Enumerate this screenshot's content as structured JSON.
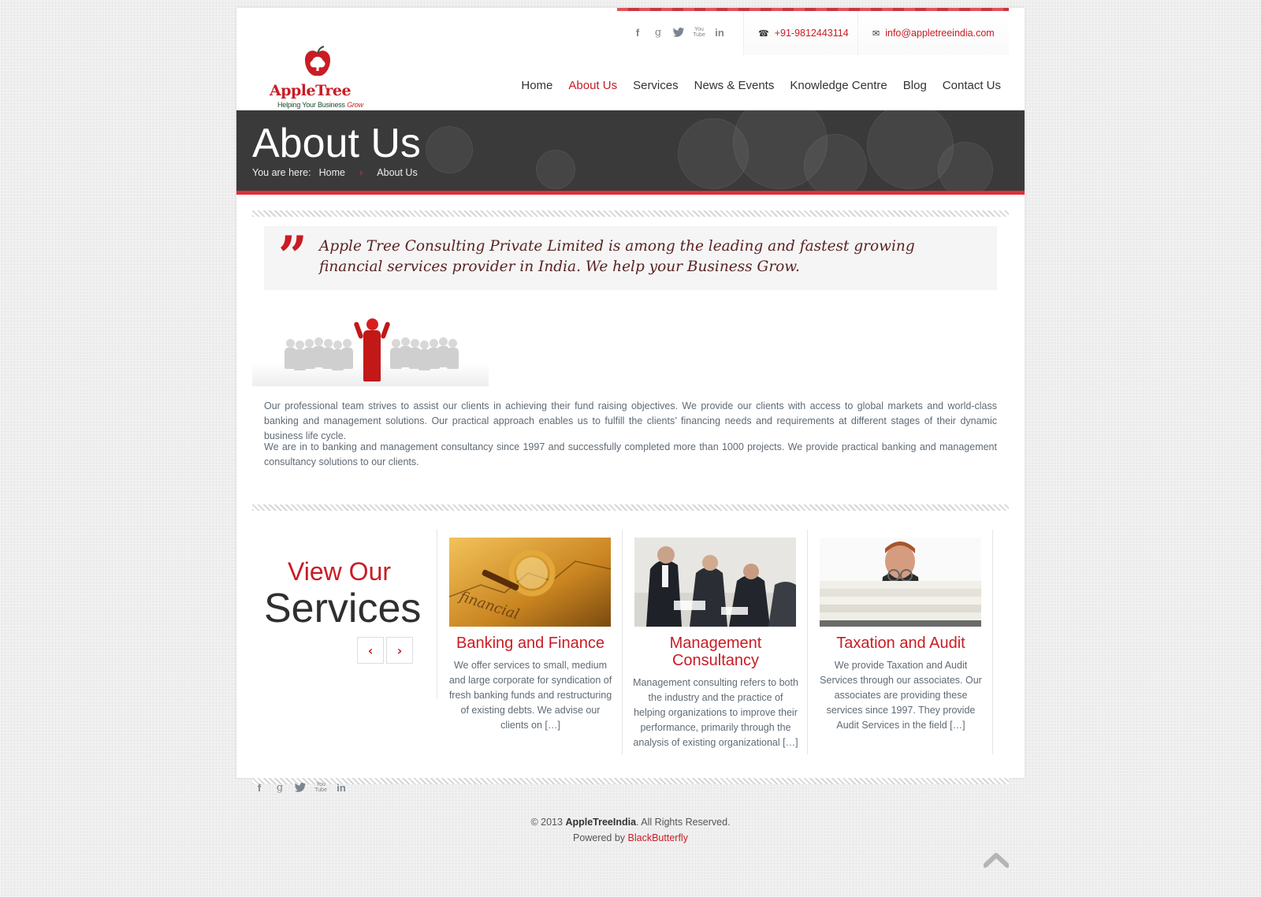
{
  "header": {
    "brand": "AppleTree",
    "tagline_main": "Helping Your Business",
    "tagline_accent": "Grow",
    "social": [
      "facebook-icon",
      "google-plus-icon",
      "twitter-icon",
      "youtube-icon",
      "linkedin-icon"
    ],
    "phone": "+91-9812443114",
    "email": "info@appletreeindia.com",
    "nav": [
      "Home",
      "About Us",
      "Services",
      "News & Events",
      "Knowledge Centre",
      "Blog",
      "Contact Us"
    ],
    "active_nav": "About Us"
  },
  "banner": {
    "title": "About Us",
    "breadcrumb_prefix": "You are here:",
    "breadcrumb_home": "Home",
    "breadcrumb_current": "About Us"
  },
  "quote": {
    "text": "Apple Tree Consulting Private Limited is among the leading and fastest growing financial services provider in India. We help your Business Grow."
  },
  "about": {
    "p1": "Our professional team strives to assist our clients in achieving their fund raising objectives. We provide our clients with access to global markets and world-class banking and management solutions.  Our practical approach enables us to fulfill the clients’ financing needs and requirements at different stages of their dynamic business life cycle.",
    "p2": "We are in to banking and management consultancy since 1997 and successfully completed more than 1000 projects.  We provide practical banking and management consultancy solutions to our clients."
  },
  "services": {
    "heading_top": "View Our",
    "heading_bottom": "Services",
    "items": [
      {
        "title": "Banking and Finance",
        "text": "We offer services to small, medium and large corporate for syndication of fresh banking funds and restructuring of existing debts.  We advise our clients on […]"
      },
      {
        "title": "Management Consultancy",
        "text": "Management consulting refers to both the industry and the practice of helping organizations to improve their performance, primarily through the analysis of existing organizational […]"
      },
      {
        "title": "Taxation and Audit",
        "text": "We provide Taxation and Audit Services through our associates.  Our associates are providing these services since 1997.  They provide Audit Services in the field […]"
      }
    ]
  },
  "footer": {
    "copyright_prefix": "© 2013",
    "company": "AppleTreeIndia",
    "rights": ". All Rights Reserved.",
    "powered_prefix": "Powered by",
    "powered_by": "BlackButterfly"
  },
  "colors": {
    "accent": "#c91c24",
    "banner": "#3a3a3a",
    "banner_border": "#e03039"
  }
}
